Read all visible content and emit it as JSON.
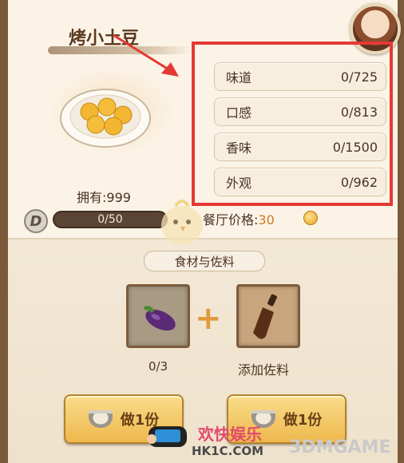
{
  "dish": {
    "title": "烤小土豆",
    "owned": "拥有:999",
    "level_badge": "D",
    "progress_text": "0/50",
    "price_label": "餐厅价格:",
    "price_value": "30"
  },
  "stats": [
    {
      "label": "味道",
      "value": "0/725"
    },
    {
      "label": "口感",
      "value": "0/813"
    },
    {
      "label": "香味",
      "value": "0/1500"
    },
    {
      "label": "外观",
      "value": "0/962"
    }
  ],
  "ingredients": {
    "section_label": "食材与佐料",
    "ingredient_count": "0/3",
    "sauce_label": "添加佐料",
    "plus": "+"
  },
  "buttons": {
    "cook_left": "做1份",
    "cook_right": "做1份"
  },
  "watermark": {
    "text1": "欢快娱乐",
    "text2": "HK1C.COM",
    "text3": "3DMGAME"
  },
  "colors": {
    "highlight_box": "#e53935",
    "button": "#eeb84c",
    "price": "#d07a1f"
  }
}
